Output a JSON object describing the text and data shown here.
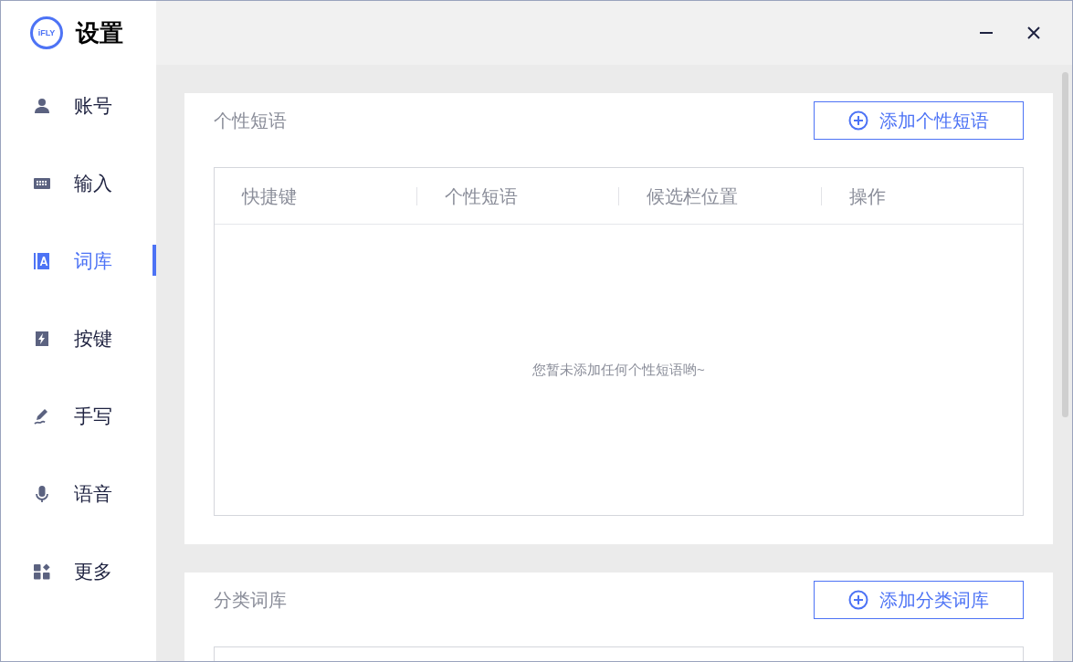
{
  "app": {
    "logo_text": "iFLY",
    "title": "设置"
  },
  "window_controls": [
    {
      "kind": "minimize"
    },
    {
      "kind": "close"
    }
  ],
  "sidebar": {
    "items": [
      {
        "label": "账号",
        "kind": "user",
        "selected": false
      },
      {
        "label": "输入",
        "kind": "keyboard",
        "selected": false
      },
      {
        "label": "词库",
        "kind": "dictionary",
        "selected": true
      },
      {
        "label": "按键",
        "kind": "key",
        "selected": false
      },
      {
        "label": "手写",
        "kind": "pen",
        "selected": false
      },
      {
        "label": "语音",
        "kind": "mic",
        "selected": false
      },
      {
        "label": "更多",
        "kind": "more",
        "selected": false
      }
    ]
  },
  "sections": [
    {
      "title": "个性短语",
      "button": "添加个性短语",
      "table": {
        "columns": [
          "快捷键",
          "个性短语",
          "候选栏位置",
          "操作"
        ],
        "empty_text": "您暂未添加任何个性短语哟~"
      }
    },
    {
      "title": "分类词库",
      "button": "添加分类词库"
    }
  ]
}
